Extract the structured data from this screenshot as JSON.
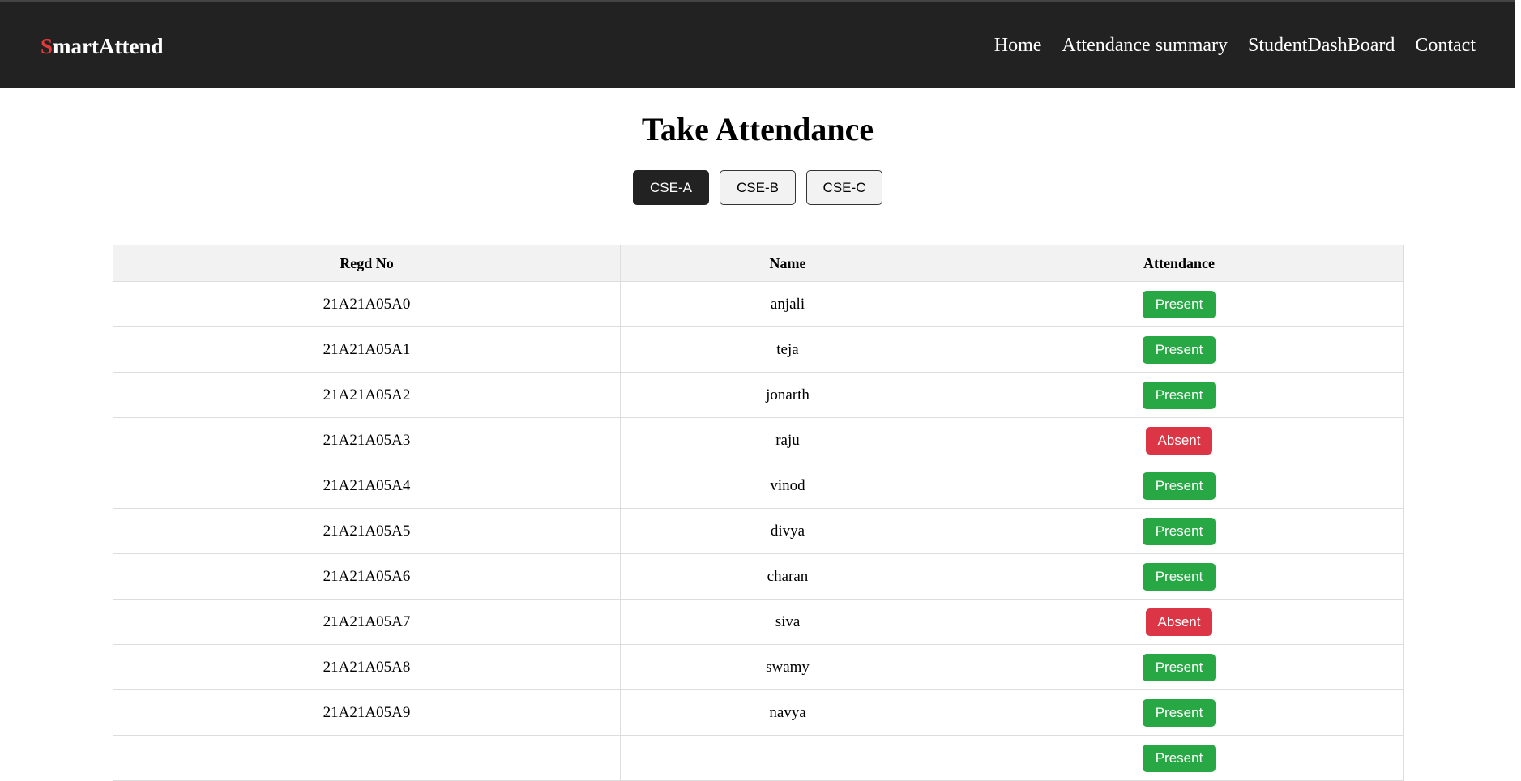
{
  "navbar": {
    "brand_first": "S",
    "brand_rest": "martAttend",
    "links": [
      "Home",
      "Attendance summary",
      "StudentDashBoard",
      "Contact"
    ]
  },
  "page": {
    "title": "Take Attendance"
  },
  "sections": {
    "items": [
      "CSE-A",
      "CSE-B",
      "CSE-C"
    ],
    "active": "CSE-A"
  },
  "table": {
    "headers": [
      "Regd No",
      "Name",
      "Attendance"
    ],
    "rows": [
      {
        "regd": "21A21A05A0",
        "name": "anjali",
        "status": "Present"
      },
      {
        "regd": "21A21A05A1",
        "name": "teja",
        "status": "Present"
      },
      {
        "regd": "21A21A05A2",
        "name": "jonarth",
        "status": "Present"
      },
      {
        "regd": "21A21A05A3",
        "name": "raju",
        "status": "Absent"
      },
      {
        "regd": "21A21A05A4",
        "name": "vinod",
        "status": "Present"
      },
      {
        "regd": "21A21A05A5",
        "name": "divya",
        "status": "Present"
      },
      {
        "regd": "21A21A05A6",
        "name": "charan",
        "status": "Present"
      },
      {
        "regd": "21A21A05A7",
        "name": "siva",
        "status": "Absent"
      },
      {
        "regd": "21A21A05A8",
        "name": "swamy",
        "status": "Present"
      },
      {
        "regd": "21A21A05A9",
        "name": "navya",
        "status": "Present"
      },
      {
        "regd": "",
        "name": "",
        "status": "Present"
      }
    ]
  },
  "colors": {
    "navbar_bg": "#222222",
    "brand_accent": "#e53a3a",
    "present": "#28a745",
    "absent": "#dc3545"
  }
}
